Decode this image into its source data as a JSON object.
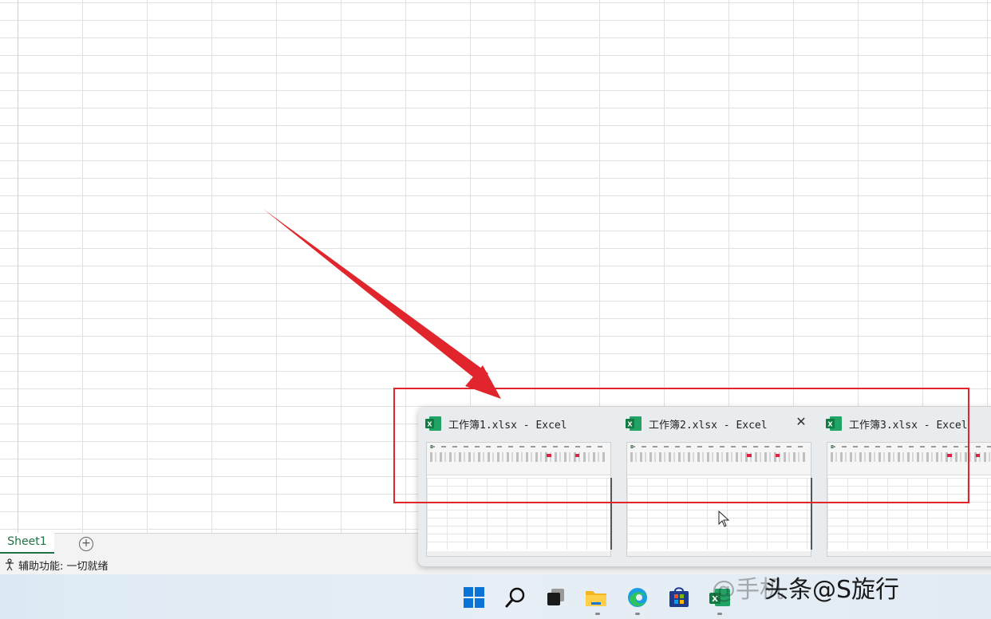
{
  "sheet_tabs": [
    {
      "label": "Sheet1"
    }
  ],
  "add_sheet_label": "+",
  "status": {
    "text": "辅助功能: 一切就绪"
  },
  "thumbnails": [
    {
      "title": "工作簿1.xlsx - Excel",
      "show_close": false
    },
    {
      "title": "工作簿2.xlsx - Excel",
      "show_close": true
    },
    {
      "title": "工作簿3.xlsx - Excel",
      "show_close": false
    }
  ],
  "close_glyph": "✕",
  "taskbar": {
    "icons": [
      "windows-start-icon",
      "search-icon",
      "task-view-icon",
      "file-explorer-icon",
      "edge-browser-icon",
      "microsoft-store-icon",
      "excel-icon"
    ]
  },
  "watermark": "@手机",
  "watermark2": "头条@S旋行",
  "colors": {
    "annotation": "#e0262c",
    "excel_green": "#1e7145"
  }
}
